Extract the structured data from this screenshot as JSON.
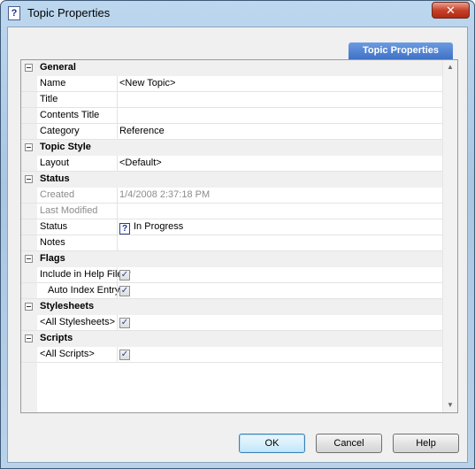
{
  "window": {
    "title": "Topic Properties",
    "title_icon": "help-topic-icon",
    "close_label": "✕"
  },
  "tab": {
    "label": "Topic Properties"
  },
  "categories": {
    "general": "General",
    "topic_style": "Topic Style",
    "status": "Status",
    "flags": "Flags",
    "stylesheets": "Stylesheets",
    "scripts": "Scripts"
  },
  "properties": {
    "name": {
      "label": "Name",
      "value": "<New Topic>"
    },
    "title": {
      "label": "Title",
      "value": ""
    },
    "contents_title": {
      "label": "Contents Title",
      "value": ""
    },
    "category": {
      "label": "Category",
      "value": "Reference"
    },
    "layout": {
      "label": "Layout",
      "value": "<Default>"
    },
    "created": {
      "label": "Created",
      "value": "1/4/2008 2:37:18 PM"
    },
    "last_modified": {
      "label": "Last Modified",
      "value": ""
    },
    "status": {
      "label": "Status",
      "value": "In Progress",
      "icon": "help-status-icon"
    },
    "notes": {
      "label": "Notes",
      "value": ""
    },
    "include_in_help": {
      "label": "Include in Help File ?",
      "checked": true
    },
    "auto_index": {
      "label": "Auto Index Entry ?",
      "checked": true
    },
    "all_stylesheets": {
      "label": "<All Stylesheets>",
      "checked": true
    },
    "all_scripts": {
      "label": "<All Scripts>",
      "checked": true
    }
  },
  "buttons": {
    "ok": "OK",
    "cancel": "Cancel",
    "help": "Help"
  },
  "glyphs": {
    "check": "✓",
    "help": "?",
    "scroll_up": "▲",
    "scroll_down": "▼"
  }
}
